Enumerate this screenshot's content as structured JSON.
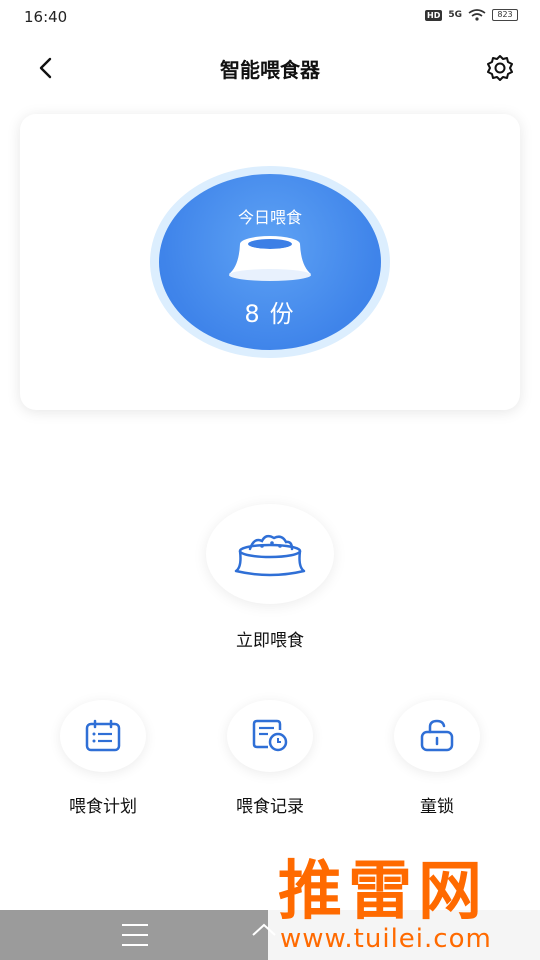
{
  "status_bar": {
    "time": "16:40",
    "hd_badge": "HD",
    "network": "5G",
    "battery": "823"
  },
  "header": {
    "title": "智能喂食器",
    "back_icon": "chevron-left-icon",
    "settings_icon": "gear-icon"
  },
  "summary": {
    "label": "今日喂食",
    "value": "8",
    "unit": "份",
    "bowl_icon": "bowl-icon",
    "accent_color": "#3f84ea"
  },
  "feed_now": {
    "label": "立即喂食",
    "icon": "food-bowl-icon"
  },
  "actions": [
    {
      "label": "喂食计划",
      "icon": "calendar-icon"
    },
    {
      "label": "喂食记录",
      "icon": "record-clock-icon"
    },
    {
      "label": "童锁",
      "icon": "unlock-icon"
    }
  ],
  "watermark": {
    "text": "推雷网",
    "url": "www.tuilei.com"
  }
}
